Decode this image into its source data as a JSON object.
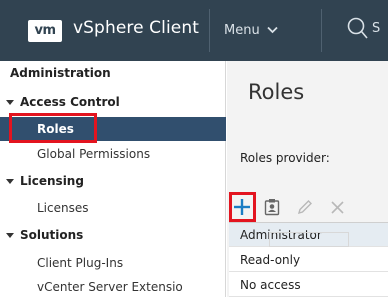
{
  "header": {
    "logo_text": "vm",
    "app_title": "vSphere Client",
    "menu_label": "Menu",
    "search_label": "S"
  },
  "sidebar": {
    "heading": "Administration",
    "groups": [
      {
        "label": "Access Control",
        "items": [
          "Roles",
          "Global Permissions"
        ]
      },
      {
        "label": "Licensing",
        "items": [
          "Licenses"
        ]
      },
      {
        "label": "Solutions",
        "items": [
          "Client Plug-Ins",
          "vCenter Server Extensio"
        ]
      }
    ],
    "selected_item": "Roles"
  },
  "main": {
    "title": "Roles",
    "provider_label": "Roles provider:",
    "roles": [
      "Administrator",
      "Read-only",
      "No access"
    ]
  },
  "colors": {
    "header_bg": "#314351",
    "selected_bg": "#314f6e",
    "accent_blue": "#1b7dc4",
    "highlight_red": "#e3141f"
  }
}
